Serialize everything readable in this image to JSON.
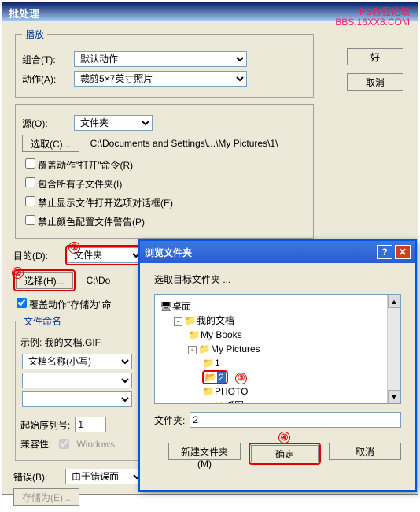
{
  "watermark": {
    "line1": "PS教程论坛",
    "line2": "BBS.16XX8.COM"
  },
  "main": {
    "title": "批处理",
    "buttons": {
      "ok": "好",
      "cancel": "取消"
    },
    "play": {
      "legend": "播放",
      "set_label": "组合(T):",
      "set_value": "默认动作",
      "action_label": "动作(A):",
      "action_value": "裁剪5×7英寸照片"
    },
    "source": {
      "label": "源(O):",
      "value": "文件夹",
      "choose_btn": "选取(C)...",
      "path": "C:\\Documents and Settings\\...\\My Pictures\\1\\",
      "chk1": "覆盖动作\"打开\"命令(R)",
      "chk2": "包含所有子文件夹(I)",
      "chk3": "禁止显示文件打开选项对话框(E)",
      "chk4": "禁止颜色配置文件警告(P)"
    },
    "dest": {
      "label": "目的(D):",
      "value": "文件夹",
      "choose_btn": "选择(H)...",
      "path": "C:\\Do",
      "chk_save": "覆盖动作\"存储为\"命",
      "naming_legend": "文件命名",
      "example": "示例: 我的文档.GIF",
      "name_opt": "文档名称(小写)",
      "start_label": "起始序列号:",
      "start_value": "1",
      "compat_label": "兼容性:",
      "compat_win": "Windows"
    },
    "errors": {
      "label": "错误(B):",
      "value": "由于错误而",
      "save_btn": "存储为(E)..."
    },
    "annot": {
      "n1": "①",
      "n2": "②",
      "n3": "③",
      "n4": "④"
    }
  },
  "browse": {
    "title": "浏览文件夹",
    "prompt": "选取目标文件夹 ...",
    "tree": {
      "desktop": "桌面",
      "mydocs": "我的文档",
      "mybooks": "My Books",
      "mypics": "My Pictures",
      "n1": "1",
      "n2": "2",
      "photo": "PHOTO",
      "snap": "抓图"
    },
    "folder_label": "文件夹:",
    "folder_value": "2",
    "new_btn": "新建文件夹(M)",
    "ok_btn": "确定",
    "cancel_btn": "取消"
  }
}
